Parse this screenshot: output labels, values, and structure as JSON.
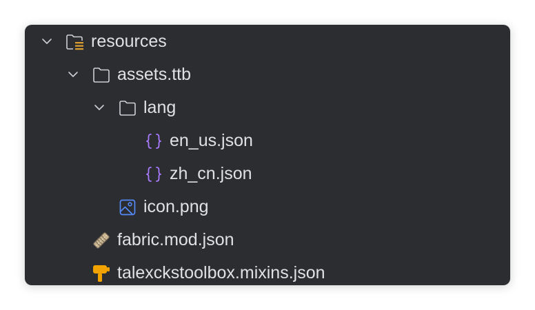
{
  "tree": {
    "nodes": [
      {
        "label": "resources",
        "icon": "resources-folder-icon",
        "expanded": true
      },
      {
        "label": "assets.ttb",
        "icon": "folder-icon",
        "expanded": true
      },
      {
        "label": "lang",
        "icon": "folder-icon",
        "expanded": true
      },
      {
        "label": "en_us.json",
        "icon": "json-braces-icon"
      },
      {
        "label": "zh_cn.json",
        "icon": "json-braces-icon"
      },
      {
        "label": "icon.png",
        "icon": "image-file-icon"
      },
      {
        "label": "fabric.mod.json",
        "icon": "fabric-icon"
      },
      {
        "label": "talexckstoolbox.mixins.json",
        "icon": "mixin-icon"
      }
    ]
  },
  "colors": {
    "panel_background": "#2b2d30",
    "text": "#dfe1e5",
    "folder_outline": "#ced0d6",
    "json_braces": "#a97bff",
    "image_icon": "#548af7",
    "resources_badge": "#e0a030",
    "mixin_icon": "#f2a300"
  }
}
